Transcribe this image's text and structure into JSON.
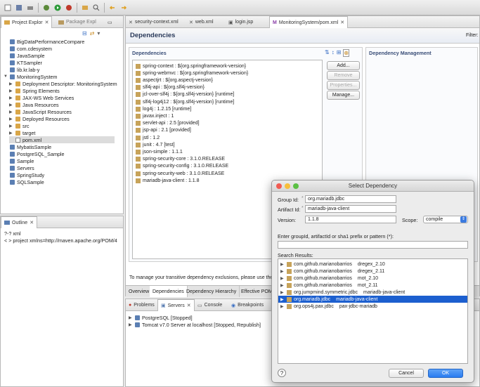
{
  "explorer": {
    "tabs": [
      "Project Explor",
      "Package Expl"
    ],
    "items": [
      {
        "label": "BigDataPerformanceCompare",
        "indent": 0,
        "kind": "proj"
      },
      {
        "label": "com.cdesystem",
        "indent": 0,
        "kind": "proj"
      },
      {
        "label": "JavaSample",
        "indent": 0,
        "kind": "proj"
      },
      {
        "label": "KTSampler",
        "indent": 0,
        "kind": "proj"
      },
      {
        "label": "lib.kr.lab-y",
        "indent": 0,
        "kind": "proj"
      },
      {
        "label": "MonitoringSystem",
        "indent": 0,
        "kind": "proj",
        "expanded": true
      },
      {
        "label": "Deployment Descriptor: MonitoringSystem",
        "indent": 1,
        "kind": "folder"
      },
      {
        "label": "Spring Elements",
        "indent": 1,
        "kind": "folder"
      },
      {
        "label": "JAX-WS Web Services",
        "indent": 1,
        "kind": "folder"
      },
      {
        "label": "Java Resources",
        "indent": 1,
        "kind": "folder"
      },
      {
        "label": "JavaScript Resources",
        "indent": 1,
        "kind": "folder"
      },
      {
        "label": "Deployed Resources",
        "indent": 1,
        "kind": "folder"
      },
      {
        "label": "src",
        "indent": 1,
        "kind": "folder"
      },
      {
        "label": "target",
        "indent": 1,
        "kind": "folder"
      },
      {
        "label": "pom.xml",
        "indent": 1,
        "kind": "file",
        "selected": true
      },
      {
        "label": "MybatisSample",
        "indent": 0,
        "kind": "proj"
      },
      {
        "label": "PostgreSQL_Sample",
        "indent": 0,
        "kind": "proj"
      },
      {
        "label": "Sample",
        "indent": 0,
        "kind": "proj"
      },
      {
        "label": "Servers",
        "indent": 0,
        "kind": "proj"
      },
      {
        "label": "SpringStudy",
        "indent": 0,
        "kind": "proj"
      },
      {
        "label": "SQLSample",
        "indent": 0,
        "kind": "proj"
      }
    ]
  },
  "outline": {
    "tab": "Outline",
    "items": [
      "?-? xml",
      "< > project xmlns=http://maven.apache.org/POM/4"
    ]
  },
  "editor": {
    "tabs": [
      "security-context.xml",
      "web.xml",
      "login.jsp",
      "MonitoringSystem/pom.xml"
    ],
    "title": "Dependencies",
    "filter_label": "Filter:",
    "deps_header": "Dependencies",
    "mgmt_header": "Dependency Management",
    "dependencies": [
      "spring-context : ${org.springframework-version}",
      "spring-webmvc : ${org.springframework-version}",
      "aspectjrt : ${org.aspectj-version}",
      "slf4j-api : ${org.slf4j-version}",
      "jcl-over-slf4j : ${org.slf4j-version} [runtime]",
      "slf4j-log4j12 : ${org.slf4j-version} [runtime]",
      "log4j : 1.2.15 [runtime]",
      "javax.inject : 1",
      "servlet-api : 2.5 [provided]",
      "jsp-api : 2.1 [provided]",
      "jstl : 1.2",
      "junit : 4.7 [test]",
      "json-simple : 1.1.1",
      "spring-security-core : 3.1.0.RELEASE",
      "spring-security-config : 3.1.0.RELEASE",
      "spring-security-web : 3.1.0.RELEASE",
      "mariadb-java-client : 1.1.8"
    ],
    "buttons": {
      "add": "Add...",
      "remove": "Remove",
      "properties": "Properties...",
      "manage": "Manage..."
    },
    "note": "To manage your transitive dependency exclusions, please use the",
    "bottom_tabs": [
      "Overview",
      "Dependencies",
      "Dependency Hierarchy",
      "Effective POM"
    ]
  },
  "servers": {
    "tabs": [
      "Problems",
      "Servers",
      "Console",
      "Breakpoints"
    ],
    "items": [
      "PostgreSQL  [Stopped]",
      "Tomcat v7.0 Server at localhost  [Stopped, Republish]"
    ]
  },
  "dialog": {
    "title": "Select Dependency",
    "group_label": "Group Id:",
    "group_value": "org.mariadb.jdbc",
    "artifact_label": "Artifact Id:",
    "artifact_value": "mariadb-java-client",
    "version_label": "Version:",
    "version_value": "1.1.8",
    "scope_label": "Scope:",
    "scope_value": "compile",
    "search_label": "Enter groupId, artifactId or sha1 prefix or pattern (*):",
    "search_value": "",
    "results_label": "Search Results:",
    "results": [
      {
        "group": "com.github.marianobarrios",
        "artifact": "dregex_2.10"
      },
      {
        "group": "com.github.marianobarrios",
        "artifact": "dregex_2.11"
      },
      {
        "group": "com.github.marianobarrios",
        "artifact": "mot_2.10"
      },
      {
        "group": "com.github.marianobarrios",
        "artifact": "mot_2.11"
      },
      {
        "group": "org.jumpmind.symmetric.jdbc",
        "artifact": "mariadb-java-client"
      },
      {
        "group": "org.mariadb.jdbc",
        "artifact": "mariadb-java-client",
        "selected": true
      },
      {
        "group": "org.ops4j.pax.jdbc",
        "artifact": "pax-jdbc-mariadb"
      }
    ],
    "cancel": "Cancel",
    "ok": "OK",
    "help": "?"
  },
  "colors": {
    "selection": "#1c5fcf",
    "header_text": "#3a4e78",
    "ok_button": "#2a7cf0"
  }
}
